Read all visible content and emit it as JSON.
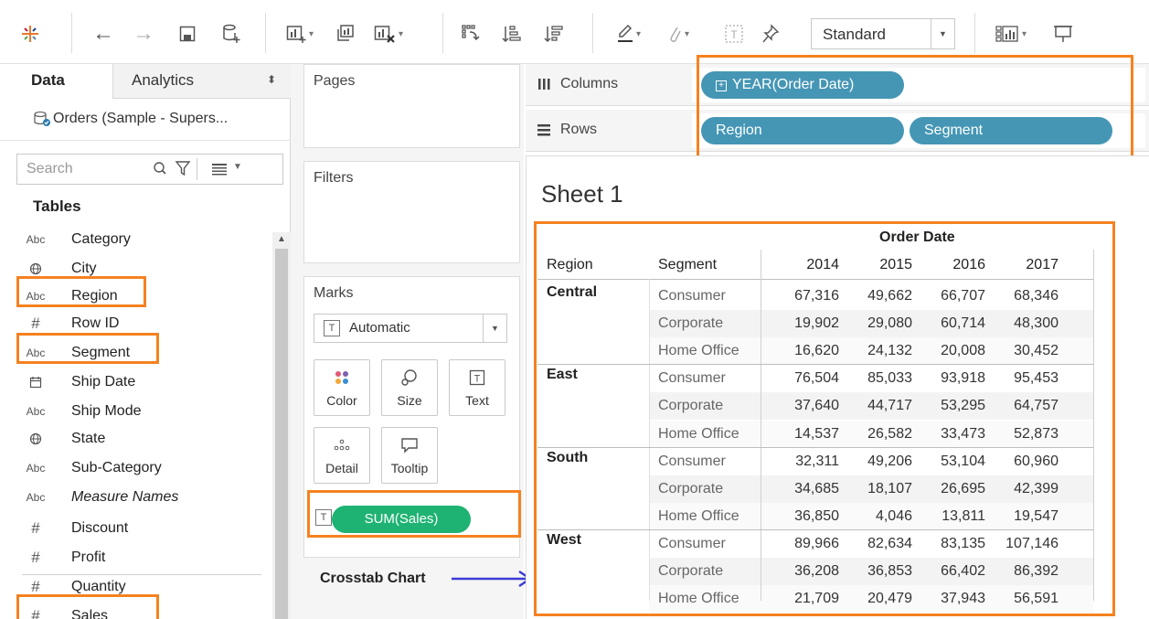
{
  "toolbar": {
    "icons": [
      "tableau-logo-icon",
      "back-arrow-icon",
      "forward-arrow-icon",
      "save-icon",
      "new-datasource-icon",
      "new-worksheet-icon",
      "duplicate-sheet-icon",
      "clear-sheet-icon",
      "swap-rows-columns-icon",
      "sort-ascending-icon",
      "sort-descending-icon",
      "highlight-icon",
      "group-icon",
      "label-icon",
      "pin-icon",
      "show-me-icon",
      "presentation-icon"
    ],
    "fit_select": "Standard"
  },
  "data_pane": {
    "tab_data": "Data",
    "tab_analytics": "Analytics",
    "datasource": "Orders (Sample - Supers...",
    "search_placeholder": "Search",
    "tables_heading": "Tables",
    "fields": [
      {
        "type": "Abc",
        "name": "Category",
        "icon": "abc-icon"
      },
      {
        "type": "globe",
        "name": "City",
        "icon": "globe-icon"
      },
      {
        "type": "Abc",
        "name": "Region",
        "icon": "abc-icon",
        "highlighted": true
      },
      {
        "type": "#",
        "name": "Row ID",
        "icon": "number-icon"
      },
      {
        "type": "Abc",
        "name": "Segment",
        "icon": "abc-icon",
        "highlighted": true
      },
      {
        "type": "date",
        "name": "Ship Date",
        "icon": "calendar-icon"
      },
      {
        "type": "Abc",
        "name": "Ship Mode",
        "icon": "abc-icon"
      },
      {
        "type": "globe",
        "name": "State",
        "icon": "globe-icon"
      },
      {
        "type": "Abc",
        "name": "Sub-Category",
        "icon": "abc-icon"
      },
      {
        "type": "Abc",
        "name": "Measure Names",
        "icon": "abc-icon"
      },
      {
        "type": "#",
        "name": "Discount",
        "icon": "number-icon"
      },
      {
        "type": "#",
        "name": "Profit",
        "icon": "number-icon"
      },
      {
        "type": "#",
        "name": "Quantity",
        "icon": "number-icon"
      },
      {
        "type": "#",
        "name": "Sales",
        "icon": "number-icon",
        "highlighted": true
      }
    ]
  },
  "cards": {
    "pages": "Pages",
    "filters": "Filters",
    "marks": "Marks",
    "mark_type": "Automatic",
    "mark_buttons": [
      "Color",
      "Size",
      "Text",
      "Detail",
      "Tooltip"
    ],
    "sum_pill": "SUM(Sales)"
  },
  "shelves": {
    "columns_label": "Columns",
    "rows_label": "Rows",
    "columns_pill": "YEAR(Order Date)",
    "rows_pills": [
      "Region",
      "Segment"
    ]
  },
  "annotation": {
    "crosstab_label": "Crosstab Chart",
    "highlight_color": "#f58220",
    "arrow_color": "#3b3bd6"
  },
  "sheet": {
    "title": "Sheet 1",
    "col_group_header": "Order Date",
    "row_headers": [
      "Region",
      "Segment"
    ],
    "years": [
      "2014",
      "2015",
      "2016",
      "2017"
    ],
    "rows": [
      {
        "region": "Central",
        "segments": [
          {
            "segment": "Consumer",
            "values": [
              "67,316",
              "49,662",
              "66,707",
              "68,346"
            ]
          },
          {
            "segment": "Corporate",
            "values": [
              "19,902",
              "29,080",
              "60,714",
              "48,300"
            ]
          },
          {
            "segment": "Home Office",
            "values": [
              "16,620",
              "24,132",
              "20,008",
              "30,452"
            ]
          }
        ]
      },
      {
        "region": "East",
        "segments": [
          {
            "segment": "Consumer",
            "values": [
              "76,504",
              "85,033",
              "93,918",
              "95,453"
            ]
          },
          {
            "segment": "Corporate",
            "values": [
              "37,640",
              "44,717",
              "53,295",
              "64,757"
            ]
          },
          {
            "segment": "Home Office",
            "values": [
              "14,537",
              "26,582",
              "33,473",
              "52,873"
            ]
          }
        ]
      },
      {
        "region": "South",
        "segments": [
          {
            "segment": "Consumer",
            "values": [
              "32,311",
              "49,206",
              "53,104",
              "60,960"
            ]
          },
          {
            "segment": "Corporate",
            "values": [
              "34,685",
              "18,107",
              "26,695",
              "42,399"
            ]
          },
          {
            "segment": "Home Office",
            "values": [
              "36,850",
              "4,046",
              "13,811",
              "19,547"
            ]
          }
        ]
      },
      {
        "region": "West",
        "segments": [
          {
            "segment": "Consumer",
            "values": [
              "89,966",
              "82,634",
              "83,135",
              "107,146"
            ]
          },
          {
            "segment": "Corporate",
            "values": [
              "36,208",
              "36,853",
              "66,402",
              "86,392"
            ]
          },
          {
            "segment": "Home Office",
            "values": [
              "21,709",
              "20,479",
              "37,943",
              "56,591"
            ]
          }
        ]
      }
    ]
  }
}
